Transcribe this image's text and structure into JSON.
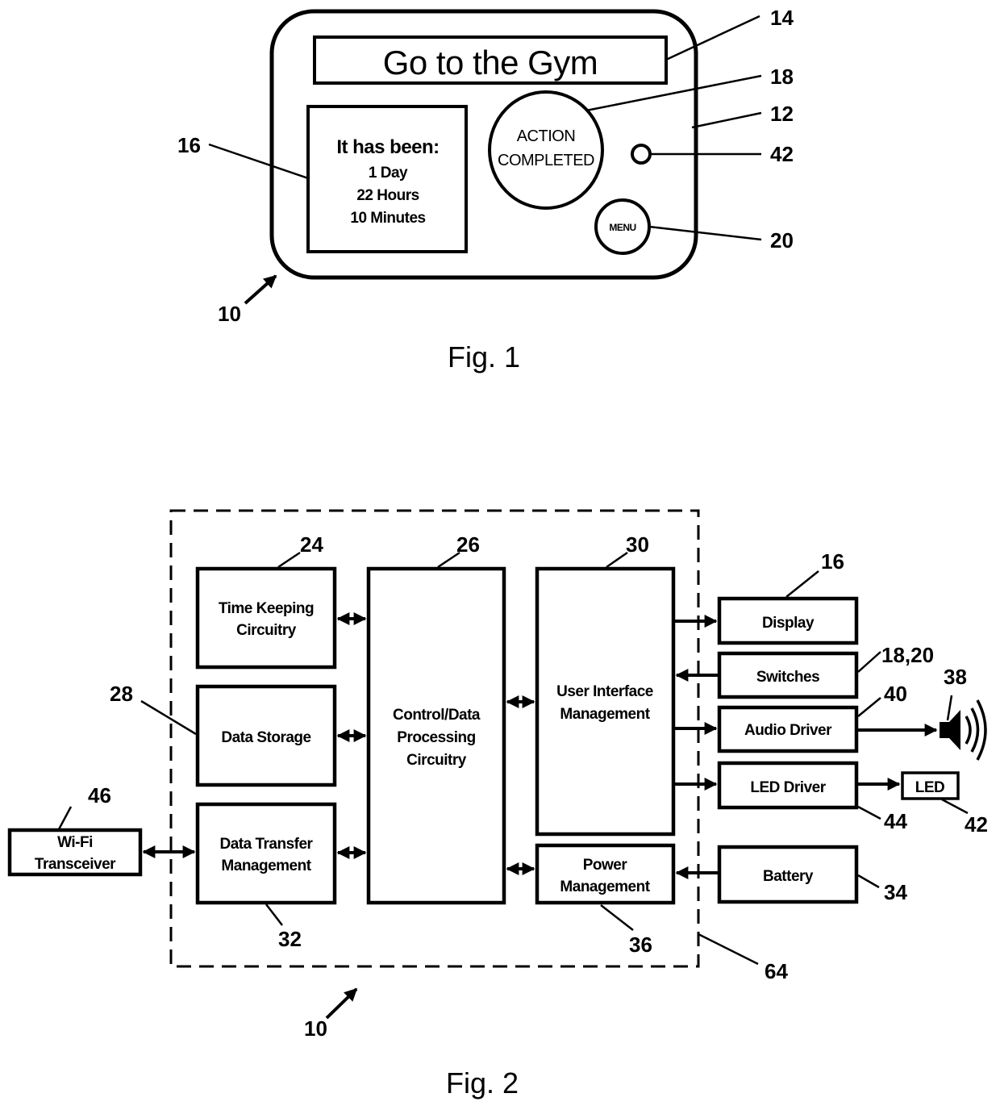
{
  "fig1": {
    "caption": "Fig. 1",
    "device": {
      "message": "Go to the Gym",
      "timer_heading": "It has been:",
      "timer_days": "1 Day",
      "timer_hours": "22 Hours",
      "timer_minutes": "10 Minutes",
      "action_button_line1": "ACTION",
      "action_button_line2": "COMPLETED",
      "menu_button": "MENU"
    },
    "refs": {
      "device": "10",
      "housing": "12",
      "message_display": "14",
      "timer_display": "16",
      "action_button": "18",
      "menu_button": "20",
      "led": "42"
    }
  },
  "fig2": {
    "caption": "Fig. 2",
    "blocks": {
      "time_keeping": {
        "line1": "Time Keeping",
        "line2": "Circuitry",
        "ref": "24"
      },
      "data_storage": {
        "line1": "Data Storage",
        "ref": "28"
      },
      "data_transfer": {
        "line1": "Data Transfer",
        "line2": "Management",
        "ref": "32"
      },
      "control": {
        "line1": "Control/Data",
        "line2": "Processing",
        "line3": "Circuitry",
        "ref": "26"
      },
      "ui_mgmt": {
        "line1": "User Interface",
        "line2": "Management",
        "ref": "30"
      },
      "power_mgmt": {
        "line1": "Power",
        "line2": "Management",
        "ref": "36"
      },
      "display": {
        "line1": "Display",
        "ref": "16"
      },
      "switches": {
        "line1": "Switches",
        "ref": "18,20"
      },
      "audio_driver": {
        "line1": "Audio Driver",
        "ref": "40"
      },
      "led_driver": {
        "line1": "LED Driver",
        "ref": "44"
      },
      "led": {
        "line1": "LED",
        "ref": "42"
      },
      "battery": {
        "line1": "Battery",
        "ref": "34"
      },
      "wifi": {
        "line1": "Wi-Fi",
        "line2": "Transceiver",
        "ref": "46"
      }
    },
    "refs": {
      "speaker": "38",
      "enclosure": "64",
      "device": "10"
    }
  }
}
